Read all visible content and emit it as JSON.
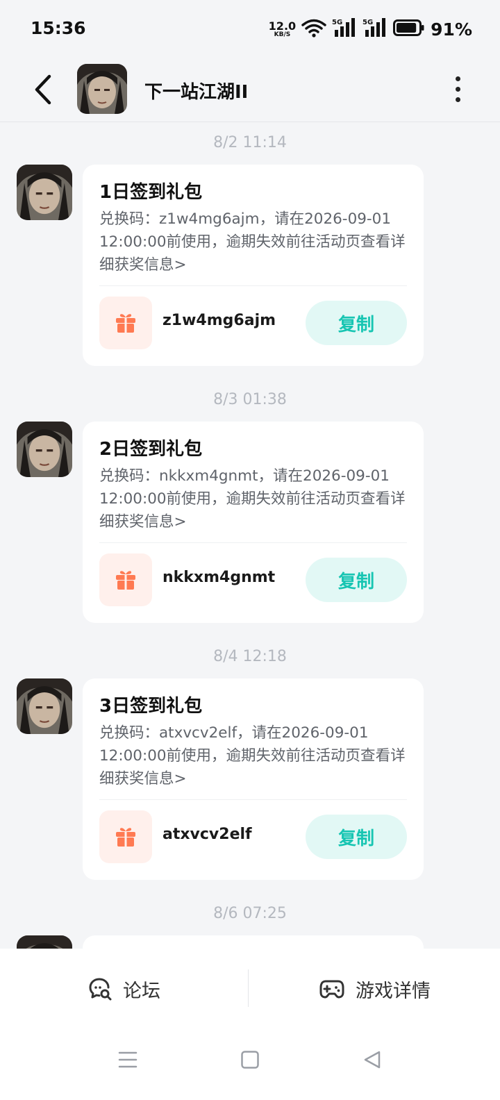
{
  "status_bar": {
    "time": "15:36",
    "net_speed_value": "12.0",
    "net_speed_unit": "KB/S",
    "signal_1_label": "5G",
    "signal_2_label": "5G",
    "battery": "91%",
    "battery_level": 0.91,
    "icons": [
      "wifi-icon",
      "signal-icon",
      "battery-icon"
    ]
  },
  "header": {
    "title": "下一站江湖II",
    "icons": [
      "back-arrow-icon",
      "more-icon"
    ]
  },
  "messages": [
    {
      "time": "8/2  11:14",
      "title": "1日签到礼包",
      "description": "兑换码：z1w4mg6ajm，请在2026-09-01 12:00:00前使用，逾期失效前往活动页查看详细获奖信息>",
      "code": "z1w4mg6ajm",
      "copy_label": "复制"
    },
    {
      "time": "8/3  01:38",
      "title": "2日签到礼包",
      "description": "兑换码：nkkxm4gnmt，请在2026-09-01 12:00:00前使用，逾期失效前往活动页查看详细获奖信息>",
      "code": "nkkxm4gnmt",
      "copy_label": "复制"
    },
    {
      "time": "8/4  12:18",
      "title": "3日签到礼包",
      "description": "兑换码：atxvcv2elf，请在2026-09-01 12:00:00前使用，逾期失效前往活动页查看详细获奖信息>",
      "code": "atxvcv2elf",
      "copy_label": "复制"
    },
    {
      "time": "8/6  07:25"
    }
  ],
  "bottom_tabs": {
    "forum": "论坛",
    "game_details": "游戏详情"
  },
  "colors": {
    "accent": "#17c5b2",
    "accent_bg": "#e2f8f5",
    "gift": "#ff7a52",
    "gift_bg": "#fff0ec",
    "page_bg": "#f4f5f7"
  }
}
